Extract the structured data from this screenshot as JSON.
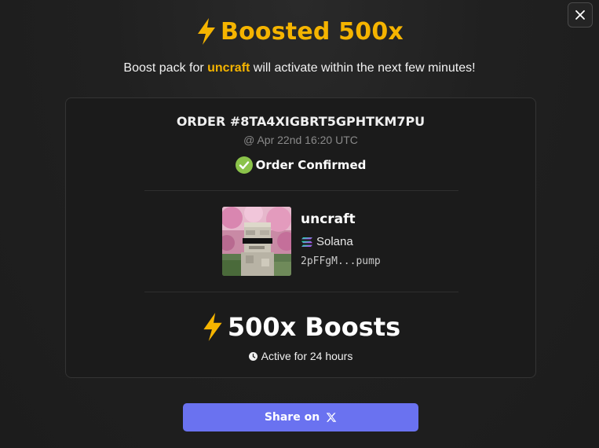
{
  "modal": {
    "title": "Boosted 500x",
    "subtitle_prefix": "Boost pack for ",
    "subtitle_token": "uncraft",
    "subtitle_suffix": " will activate within the next few minutes!"
  },
  "order": {
    "id": "ORDER #8TA4XIGBRT5GPHTKM7PU",
    "time": "@ Apr 22nd 16:20 UTC",
    "status": "Order Confirmed"
  },
  "token": {
    "name": "uncraft",
    "chain": "Solana",
    "address": "2pFFgM...pump"
  },
  "boost": {
    "amount": "500x Boosts",
    "duration": "Active for 24 hours"
  },
  "share": {
    "label": "Share on"
  },
  "icons": {
    "close": "close-icon",
    "lightning": "lightning-icon",
    "check": "check-circle-icon",
    "solana": "solana-icon",
    "clock": "clock-icon",
    "x": "x-logo-icon"
  },
  "colors": {
    "accent": "#f5b400",
    "button": "#6a72f0",
    "success": "#8bc34a"
  }
}
